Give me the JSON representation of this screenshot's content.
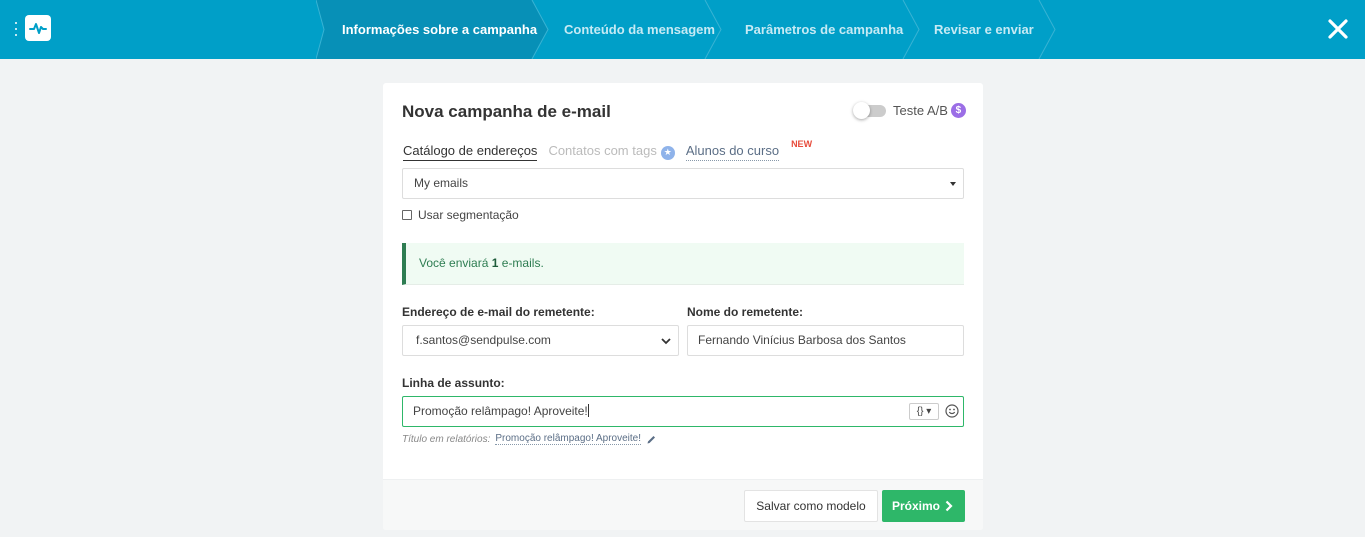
{
  "header": {
    "steps": [
      {
        "label": "Informações sobre a campanha",
        "active": true
      },
      {
        "label": "Conteúdo da mensagem",
        "active": false
      },
      {
        "label": "Parâmetros de campanha",
        "active": false
      },
      {
        "label": "Revisar e enviar",
        "active": false
      }
    ],
    "logo_icon": "pulse-icon",
    "close_icon": "close-icon",
    "menu_icon": "kebab-menu-icon"
  },
  "card": {
    "title": "Nova campanha de e-mail",
    "ab_test": {
      "label": "Teste A/B",
      "badge": "$",
      "enabled": false
    },
    "tabs": [
      {
        "label": "Catálogo de endereços",
        "state": "active"
      },
      {
        "label": "Contatos com tags",
        "state": "disabled",
        "badge_icon": "star-icon"
      },
      {
        "label": "Alunos do curso",
        "state": "link",
        "badge": "NEW"
      }
    ],
    "address_book": {
      "value": "My emails"
    },
    "segmentation": {
      "label": "Usar segmentação",
      "checked": false
    },
    "alert": {
      "prefix": "Você enviará",
      "count": "1",
      "suffix": "e-mails."
    },
    "sender_email": {
      "label": "Endereço de e-mail do remetente:",
      "value": "f.santos@sendpulse.com"
    },
    "sender_name": {
      "label": "Nome do remetente:",
      "value": "Fernando Vinícius Barbosa dos Santos"
    },
    "subject": {
      "label": "Linha de assunto:",
      "value": "Promoção relâmpago! Aproveite!",
      "variables_label": "{}"
    },
    "report_title": {
      "label": "Título em relatórios:",
      "value": "Promoção relâmpago! Aproveite!"
    },
    "footer": {
      "save_template": "Salvar como modelo",
      "next": "Próximo"
    }
  },
  "colors": {
    "header": "#009fc8",
    "primary": "#2eb769",
    "alert_bg": "#f0fbf3",
    "alert_border": "#2e7d52"
  }
}
